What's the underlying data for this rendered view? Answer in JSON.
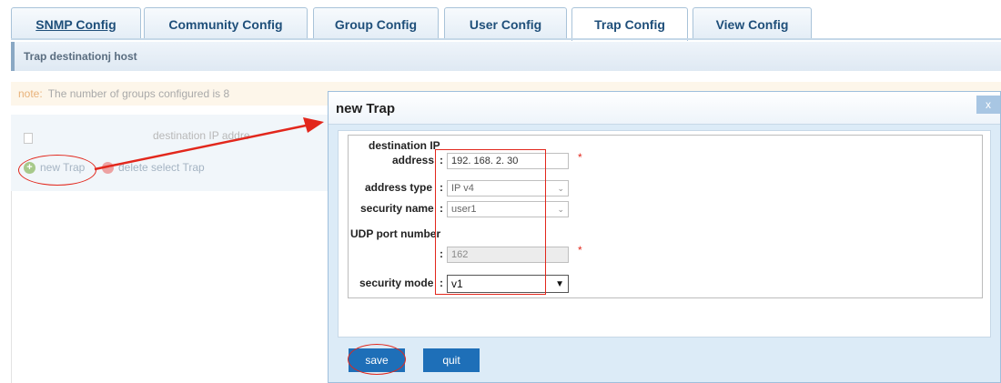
{
  "tabs": [
    {
      "label": "SNMP Config"
    },
    {
      "label": "Community Config"
    },
    {
      "label": "Group Config"
    },
    {
      "label": "User Config"
    },
    {
      "label": "Trap Config"
    },
    {
      "label": "View Config"
    }
  ],
  "breadcrumb": "Trap destinationj host",
  "note": {
    "label": "note:",
    "text": "The number of groups configured is 8"
  },
  "list": {
    "column_header": "destination IP addre"
  },
  "actions": {
    "new_trap": "new Trap",
    "delete_trap": "delete select Trap"
  },
  "dialog": {
    "title": "new Trap",
    "close": "x",
    "fields": {
      "dest_ip_label_line1": "destination IP",
      "dest_ip_label_line2": "address",
      "dest_ip_value": "192. 168. 2. 30",
      "address_type_label": "address type",
      "address_type_value": "IP v4",
      "security_name_label": "security name",
      "security_name_value": "user1",
      "udp_port_label": "UDP port number",
      "udp_port_value": "162",
      "security_mode_label": "security mode",
      "security_mode_value": "v1",
      "colon": ":",
      "required_mark": "*"
    },
    "save_label": "save",
    "quit_label": "quit"
  },
  "colors": {
    "accent": "#1e6fb8",
    "annotation": "#e2271c"
  }
}
